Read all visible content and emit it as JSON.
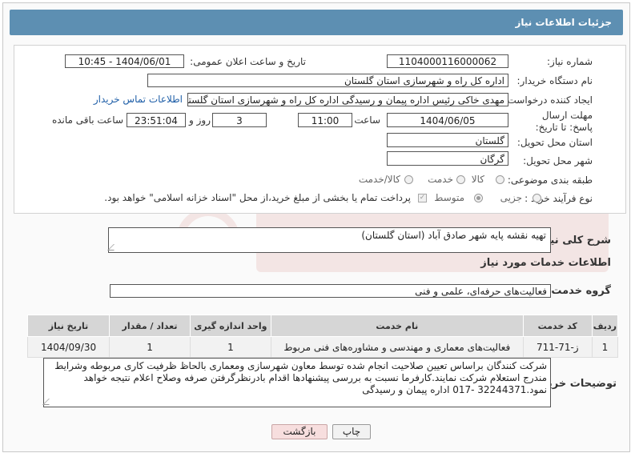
{
  "header": {
    "title": "جزئیات اطلاعات نیاز"
  },
  "form": {
    "need_number_label": "شماره نیاز:",
    "need_number": "1104000116000062",
    "announce_label": "تاریخ و ساعت اعلان عمومی:",
    "announce_value": "1404/06/01 - 10:45",
    "buyer_org_label": "نام دستگاه خریدار:",
    "buyer_org": "اداره کل راه و شهرسازی استان گلستان",
    "creator_label": "ایجاد کننده درخواست:",
    "creator": "مهدی خاکی رئیس اداره پیمان و رسیدگی اداره کل راه و شهرسازی استان گلستان",
    "contact_link": "اطلاعات تماس خریدار",
    "deadline_label": "مهلت ارسال پاسخ: تا تاریخ:",
    "deadline_date": "1404/06/05",
    "time_label": "ساعت",
    "deadline_time": "11:00",
    "days_value": "3",
    "days_label": "روز و",
    "remaining_value": "23:51:04",
    "remaining_label": "ساعت باقی مانده",
    "province_label": "استان محل تحویل:",
    "province": "گلستان",
    "city_label": "شهر محل تحویل:",
    "city": "گرگان",
    "category_label": "طبقه بندی موضوعی:",
    "category_options": [
      "کالا",
      "خدمت",
      "کالا/خدمت"
    ],
    "process_label": "نوع فرآیند خرید :",
    "process_options": [
      "جزیی",
      "متوسط"
    ],
    "payment_note": "پرداخت تمام یا بخشی از مبلغ خرید،از محل \"اسناد خزانه اسلامی\" خواهد بود."
  },
  "summary": {
    "label": "شرح کلی نیاز:",
    "text": "تهیه نقشه پایه شهر صادق آباد (استان  گلستان)"
  },
  "services": {
    "section_title": "اطلاعات خدمات مورد نیاز",
    "group_label": "گروه خدمت:",
    "group_value": "فعالیت‌های حرفه‌ای، علمی و فنی",
    "columns": [
      "ردیف",
      "کد خدمت",
      "نام خدمت",
      "واحد اندازه گیری",
      "تعداد / مقدار",
      "تاریخ نیاز"
    ],
    "rows": [
      {
        "row": "1",
        "code": "ز-71-711",
        "name": "فعالیت‌های معماری و مهندسی و مشاوره‌های فنی مربوط",
        "unit": "1",
        "qty": "1",
        "date": "1404/09/30"
      }
    ]
  },
  "buyer_notes": {
    "label": "توضیحات خریدار:",
    "text": "شرکت کنندگان براساس تعیین صلاحیت انجام شده توسط معاون شهرسازی ومعماری بالحاظ ظرفیت کاری مربوطه وشرایط مندرج استعلام شرکت نمایند.کارفرما نسبت به بررسی پیشنهادها اقدام بادرنظرگرفتن صرفه وصلاح اعلام نتیجه خواهد نمود.32244371 -017 اداره پیمان و رسیدگی"
  },
  "buttons": {
    "print": "چاپ",
    "back": "بازگشت"
  },
  "colors": {
    "header": "#5d8fb2",
    "link": "#1f5fa8",
    "back_button": "#f7dede",
    "print_button": "#f2f2f2"
  }
}
